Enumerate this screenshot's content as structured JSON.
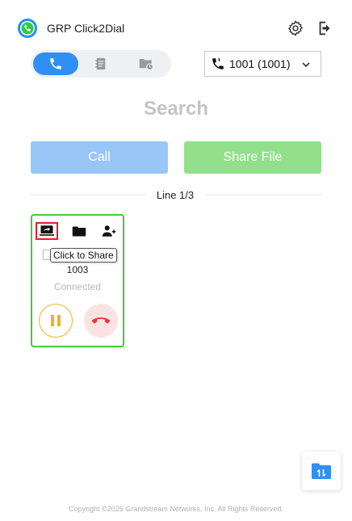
{
  "header": {
    "title": "GRP Click2Dial",
    "logo_icon": "phone-logo-icon",
    "settings_icon": "gear-icon",
    "logout_icon": "logout-icon"
  },
  "tabs": [
    {
      "icon": "phone-icon",
      "active": true
    },
    {
      "icon": "contacts-icon",
      "active": false
    },
    {
      "icon": "call-history-icon",
      "active": false
    }
  ],
  "line_selector": {
    "value": "1001 (1001)"
  },
  "search": {
    "label": "Search"
  },
  "actions": {
    "call_label": "Call",
    "share_label": "Share File"
  },
  "line_indicator": "Line 1/3",
  "call_card": {
    "tooltip": "Click to Share",
    "number": "1003",
    "status": "Connected",
    "icons": [
      "screen-share-icon",
      "folder-icon",
      "add-contact-icon",
      "pause-icon",
      "hang-up-icon"
    ]
  },
  "footer": {
    "copyright": "Copyright ©2025 Grandstream Networks, Inc. All Rights Reserved."
  },
  "colors": {
    "accent": "#2f8ff5",
    "call_button": "#98c6f7",
    "share_button": "#92e08b",
    "card_border": "#4bc63e",
    "hold": "#f2b21a",
    "hangup": "#e53935"
  }
}
